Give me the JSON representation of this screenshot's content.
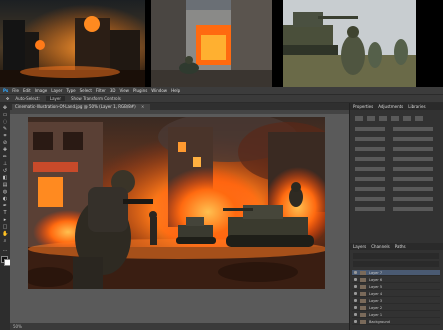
{
  "menu": {
    "app_icon": "Ps",
    "items": [
      "File",
      "Edit",
      "Image",
      "Layer",
      "Type",
      "Select",
      "Filter",
      "3D",
      "View",
      "Plugins",
      "Window",
      "Help"
    ]
  },
  "options_bar": {
    "labels": [
      "Auto-Select:",
      "Layer",
      "Show Transform Controls"
    ]
  },
  "document_tab": {
    "title": "Cinematic-Illustration-Of-Land.jpg @ 50% (Layer 1, RGB/8#)",
    "close": "×"
  },
  "properties_panel": {
    "tabs": [
      "Properties",
      "Adjustments",
      "Libraries"
    ]
  },
  "layers_panel": {
    "tabs": [
      "Layers",
      "Channels",
      "Paths"
    ],
    "layers": [
      "Layer 7",
      "Layer 6",
      "Layer 5",
      "Layer 4",
      "Layer 3",
      "Layer 2",
      "Layer 1",
      "Background"
    ]
  },
  "status_bar": {
    "zoom": "50%"
  },
  "colors": {
    "menu_bg": "#3c3c3c",
    "workspace_bg": "#535353",
    "panel_bg": "#323232",
    "selected_layer": "#4a5a72"
  }
}
